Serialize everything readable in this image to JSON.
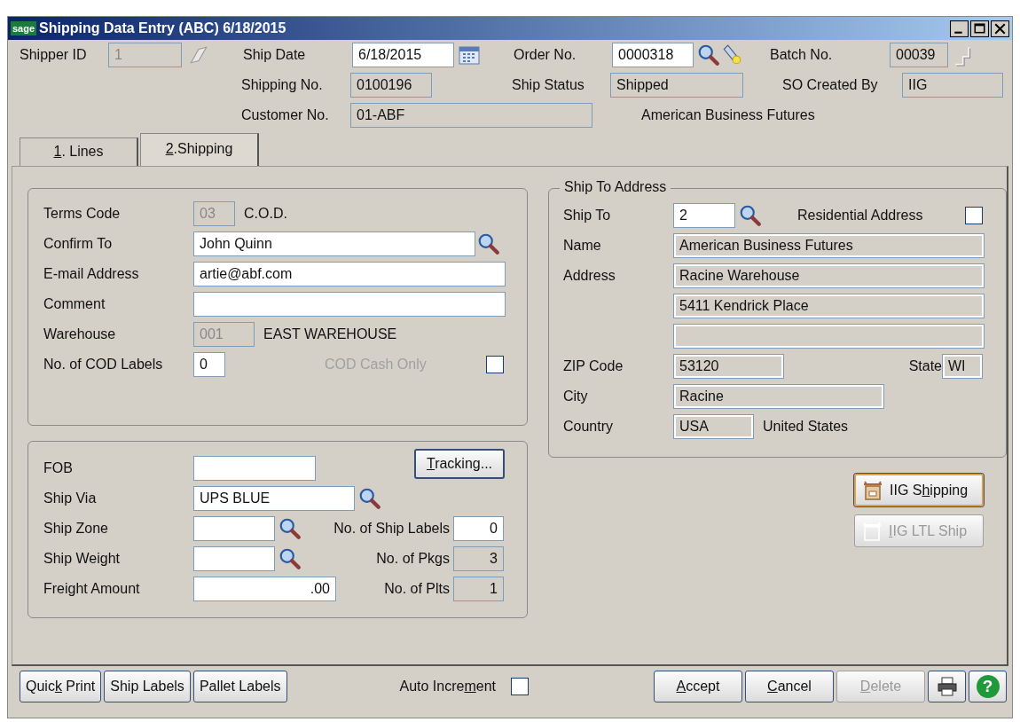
{
  "window": {
    "logo": "sage",
    "title": "Shipping Data Entry (ABC) 6/18/2015"
  },
  "header": {
    "shipper_id": {
      "label": "Shipper ID",
      "value": "1",
      "disabled": true
    },
    "ship_date": {
      "label": "Ship Date",
      "value": "6/18/2015",
      "disabled": false
    },
    "order_no": {
      "label": "Order No.",
      "value": "0000318",
      "disabled": false
    },
    "batch_no": {
      "label": "Batch No.",
      "value": "00039",
      "disabled": true
    },
    "shipping_no": {
      "label": "Shipping No.",
      "value": "0100196",
      "disabled": true
    },
    "ship_status": {
      "label": "Ship Status",
      "value": "Shipped",
      "disabled": true
    },
    "so_created_by": {
      "label": "SO Created By",
      "value": "IIG",
      "disabled": true
    },
    "customer_no": {
      "label": "Customer No.",
      "value": "01-ABF",
      "disabled": true
    },
    "customer_name": "American Business Futures"
  },
  "tabs": [
    {
      "hotkey": "1",
      "after": ". Lines",
      "selected": false
    },
    {
      "hotkey": "2",
      "after": ".Shipping",
      "selected": true
    }
  ],
  "confirmation": {
    "terms_code": {
      "label": "Terms Code",
      "value": "03",
      "disabled": true,
      "description": "C.O.D."
    },
    "confirm_to": {
      "label": "Confirm To",
      "value": "John Quinn",
      "disabled": false
    },
    "email": {
      "label": "E-mail Address",
      "value": "artie@abf.com",
      "disabled": false
    },
    "comment": {
      "label": "Comment",
      "disabled": false
    },
    "warehouse": {
      "label": "Warehouse",
      "value": "001",
      "disabled": true,
      "description": "EAST WAREHOUSE"
    },
    "cod_labels": {
      "label": "No. of COD Labels",
      "value": "0",
      "disabled": false
    },
    "cod_cash_only": {
      "label": "COD Cash Only",
      "checked": false,
      "disabled": true
    }
  },
  "shipping": {
    "fob": {
      "label": "FOB",
      "disabled": false
    },
    "tracking_button": {
      "hotkey": "T",
      "after": "racking..."
    },
    "ship_via": {
      "label": "Ship Via",
      "value": "UPS BLUE",
      "disabled": false
    },
    "ship_zone": {
      "label": "Ship Zone",
      "disabled": false
    },
    "ship_labels": {
      "label": "No. of Ship Labels",
      "value": "0",
      "disabled": false
    },
    "ship_weight": {
      "label": "Ship Weight",
      "disabled": false
    },
    "pkgs": {
      "label": "No. of Pkgs",
      "value": "3",
      "disabled": true
    },
    "freight_amount": {
      "label": "Freight Amount",
      "value": ".00",
      "disabled": false
    },
    "plts": {
      "label": "No. of Plts",
      "value": "1",
      "disabled": true
    }
  },
  "ship_to_address": {
    "title": "Ship To Address",
    "ship_to": {
      "label": "Ship To",
      "value": "2",
      "disabled": false
    },
    "residential": {
      "label": "Residential Address",
      "checked": false
    },
    "name": {
      "label": "Name",
      "value": "American Business Futures",
      "disabled": true
    },
    "address_label": "Address",
    "address_lines": [
      {
        "value": "Racine Warehouse",
        "disabled": true
      },
      {
        "value": "5411 Kendrick Place",
        "disabled": true
      },
      {
        "disabled": true
      }
    ],
    "zip": {
      "label": "ZIP Code",
      "value": "53120",
      "disabled": true
    },
    "state": {
      "label": "State",
      "value": "WI",
      "disabled": true
    },
    "city": {
      "label": "City",
      "value": "Racine",
      "disabled": true
    },
    "country": {
      "label": "Country",
      "value": "USA",
      "disabled": true,
      "description": "United States"
    }
  },
  "side_buttons": [
    {
      "before": "IIG S",
      "hotkey": "h",
      "after": "ipping",
      "disabled": false,
      "focused": true
    },
    {
      "hotkey": "I",
      "after": "IG LTL Ship",
      "disabled": true,
      "focused": false
    }
  ],
  "bottom_left_buttons": [
    {
      "before": "Quic",
      "hotkey": "k",
      "after": " Print"
    },
    {
      "before": "Ship Labels"
    },
    {
      "before": "Pallet Labels"
    }
  ],
  "auto_increment": {
    "before": "Auto Incre",
    "hotkey": "m",
    "after": "ent",
    "checked": false
  },
  "bottom_right_buttons": [
    {
      "hotkey": "A",
      "after": "ccept",
      "disabled": false
    },
    {
      "hotkey": "C",
      "after": "ancel",
      "disabled": false
    },
    {
      "hotkey": "D",
      "after": "elete",
      "disabled": true
    }
  ],
  "help_glyph": "?"
}
